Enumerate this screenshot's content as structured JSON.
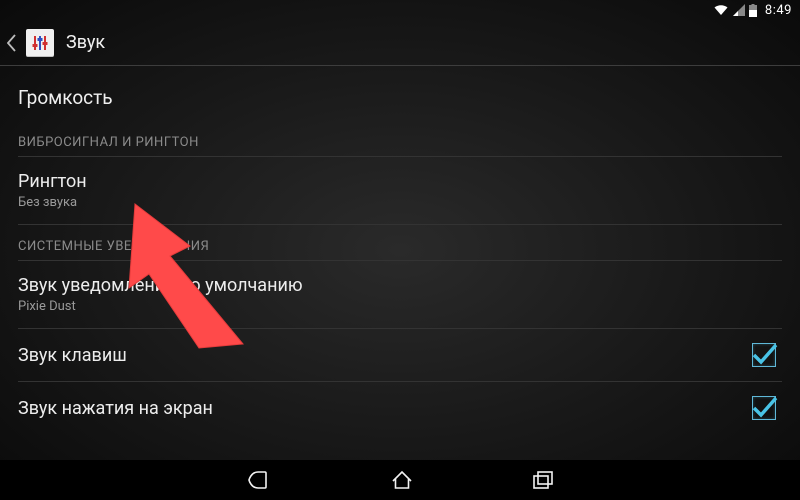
{
  "status": {
    "time": "8:49"
  },
  "header": {
    "title": "Звук"
  },
  "rows": {
    "volume": "Громкость",
    "section_vibro": "ВИБРОСИГНАЛ И РИНГТОН",
    "ringtone_title": "Рингтон",
    "ringtone_sub": "Без звука",
    "section_system": "СИСТЕМНЫЕ УВЕДОМЛЕНИЯ",
    "notif_title": "Звук уведомлений по умолчанию",
    "notif_sub": "Pixie Dust",
    "key_sounds": "Звук клавиш",
    "touch_sounds": "Звук нажатия на экран"
  }
}
